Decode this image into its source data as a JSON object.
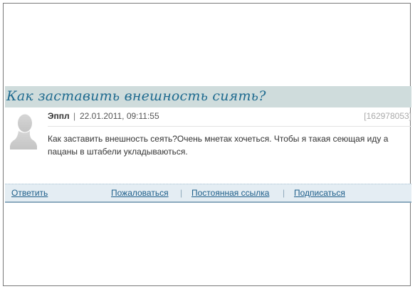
{
  "question": {
    "title": "Как заставить внешность сиять?",
    "author": "Эппл",
    "separator": "|",
    "date": "22.01.2011, 09:11:55",
    "id": "[162978053]",
    "body": "Как заставить внешность сеять?Очень мнетак хочеться. Чтобы я такая сеющая иду а пацаны в штабели укладываються.",
    "avatar_icon": "default-avatar-silhouette-icon"
  },
  "actions": {
    "reply": "Ответить",
    "complain": "Пожаловаться",
    "permalink": "Постоянная ссылка",
    "subscribe": "Подписаться",
    "separator": "|"
  },
  "colors": {
    "title_bar_bg": "#cfdcdc",
    "title_text": "#1e6a8f",
    "link": "#1d5e8a",
    "actions_bar_bg": "#e4edf3"
  }
}
